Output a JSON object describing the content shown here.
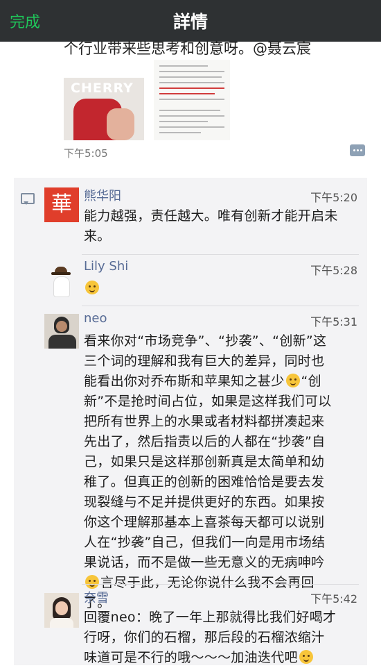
{
  "navbar": {
    "done_label": "完成",
    "title": "詳情"
  },
  "post": {
    "text_partial": "个行业带来些思考和创意呀。@聂云宸",
    "image1_word": "CHERRY",
    "time": "下午5:05",
    "more_icon": "more-dots-icon"
  },
  "comments": [
    {
      "name": "熊华阳",
      "time": "下午5:20",
      "avatar_char": "華",
      "text": "能力越强，责任越大。唯有创新才能开启未来。"
    },
    {
      "name": "Lily Shi",
      "time": "下午5:28",
      "text": ""
    },
    {
      "name": "neo",
      "time": "下午5:31",
      "text_lines": [
        "看来你对“市场竞争”、“抄袭”、“创新”这",
        "三个词的理解和我有巨大的差异，同时也",
        "能看出你对乔布斯和苹果知之甚少",
        "新”不是抢时间占位，如果是这样我们可以",
        "把所有世界上的水果或者材料都拼凑起来",
        "先出了，然后指责以后的人都在“抄袭”自",
        "己，如果只是这样那创新真是太简单和幼",
        "稚了。但真正的创新的困难恰恰是要去发",
        "现裂缝与不足并提供更好的东西。如果按",
        "你这个理解那基本上喜茶每天都可以说别",
        "人在“抄袭”自己，但我们一向是用市场结",
        "果说话，而不是做一些无意义的无病呻吟",
        "言尽于此，无论你说什么我不会再回",
        "了。"
      ],
      "line3_tail": "“创",
      "line3_head": "能看出你对乔布斯和苹果知之甚少"
    },
    {
      "name": "奈雪",
      "time": "下午5:42",
      "text_lines": [
        "回覆neo：晚了一年上那就得比我们好喝才",
        "行呀，你们的石榴，那后段的石榴浓缩汁",
        "味道可是不行的哦～～～加油迭代吧"
      ]
    }
  ],
  "colors": {
    "navbar": "#2e3133",
    "done": "#1fc65a",
    "name": "#576b95",
    "comment_bg": "#f3f3f5"
  }
}
